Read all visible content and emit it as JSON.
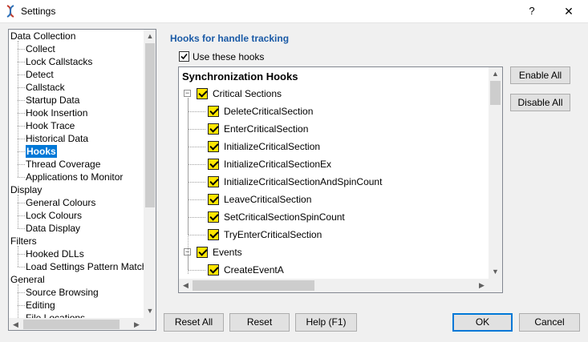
{
  "window": {
    "title": "Settings",
    "help_label": "?",
    "close_label": "✕"
  },
  "nav": {
    "items": [
      {
        "label": "Data Collection",
        "level": 0
      },
      {
        "label": "Collect",
        "level": 1
      },
      {
        "label": "Lock Callstacks",
        "level": 1
      },
      {
        "label": "Detect",
        "level": 1
      },
      {
        "label": "Callstack",
        "level": 1
      },
      {
        "label": "Startup Data",
        "level": 1
      },
      {
        "label": "Hook Insertion",
        "level": 1
      },
      {
        "label": "Hook Trace",
        "level": 1
      },
      {
        "label": "Historical Data",
        "level": 1
      },
      {
        "label": "Hooks",
        "level": 1,
        "selected": true
      },
      {
        "label": "Thread Coverage",
        "level": 1
      },
      {
        "label": "Applications to Monitor",
        "level": 1
      },
      {
        "label": "Display",
        "level": 0
      },
      {
        "label": "General Colours",
        "level": 1
      },
      {
        "label": "Lock Colours",
        "level": 1
      },
      {
        "label": "Data Display",
        "level": 1
      },
      {
        "label": "Filters",
        "level": 0
      },
      {
        "label": "Hooked DLLs",
        "level": 1
      },
      {
        "label": "Load Settings Pattern Match",
        "level": 1
      },
      {
        "label": "General",
        "level": 0
      },
      {
        "label": "Source Browsing",
        "level": 1
      },
      {
        "label": "Editing",
        "level": 1
      },
      {
        "label": "File Locations",
        "level": 1
      }
    ]
  },
  "page": {
    "section_title": "Hooks for handle tracking",
    "use_hooks_label": "Use these hooks",
    "use_hooks_checked": true
  },
  "hooks": {
    "header": "Synchronization Hooks",
    "rows": [
      {
        "label": "Critical Sections",
        "level": 0,
        "expander": "−"
      },
      {
        "label": "DeleteCriticalSection",
        "level": 1
      },
      {
        "label": "EnterCriticalSection",
        "level": 1
      },
      {
        "label": "InitializeCriticalSection",
        "level": 1
      },
      {
        "label": "InitializeCriticalSectionEx",
        "level": 1
      },
      {
        "label": "InitializeCriticalSectionAndSpinCount",
        "level": 1
      },
      {
        "label": "LeaveCriticalSection",
        "level": 1
      },
      {
        "label": "SetCriticalSectionSpinCount",
        "level": 1
      },
      {
        "label": "TryEnterCriticalSection",
        "level": 1
      },
      {
        "label": "Events",
        "level": 0,
        "expander": "−"
      },
      {
        "label": "CreateEventA",
        "level": 1
      }
    ]
  },
  "buttons": {
    "enable_all": "Enable All",
    "disable_all": "Disable All",
    "reset_all": "Reset All",
    "reset": "Reset",
    "help": "Help (F1)",
    "ok": "OK",
    "cancel": "Cancel"
  },
  "scroll_icons": {
    "up": "▲",
    "down": "▼",
    "left": "◀",
    "right": "▶"
  },
  "colors": {
    "accent": "#0078d7",
    "section_title": "#1a5aa6",
    "checkbox_fill": "#ffe600"
  }
}
